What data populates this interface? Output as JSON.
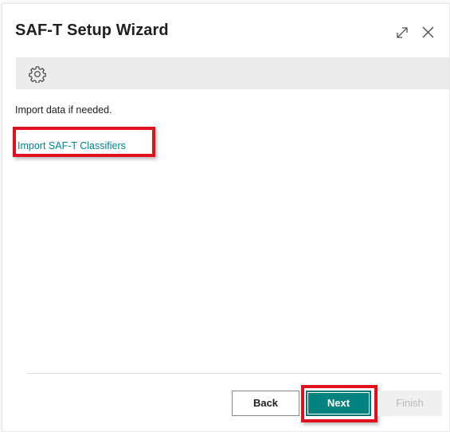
{
  "dialog": {
    "title": "SAF-T Setup Wizard"
  },
  "header_icons": {
    "expand": "expand-icon",
    "close": "close-icon"
  },
  "toolbar": {
    "settings_icon": "gear-icon"
  },
  "content": {
    "instruction": "Import data if needed.",
    "link_label": "Import SAF-T Classifiers"
  },
  "footer": {
    "back_label": "Back",
    "next_label": "Next",
    "finish_label": "Finish",
    "finish_enabled": false
  },
  "colors": {
    "accent": "#00827f",
    "link": "#00838f",
    "highlight": "#e0101e",
    "toolbar_bg": "#ececec"
  }
}
